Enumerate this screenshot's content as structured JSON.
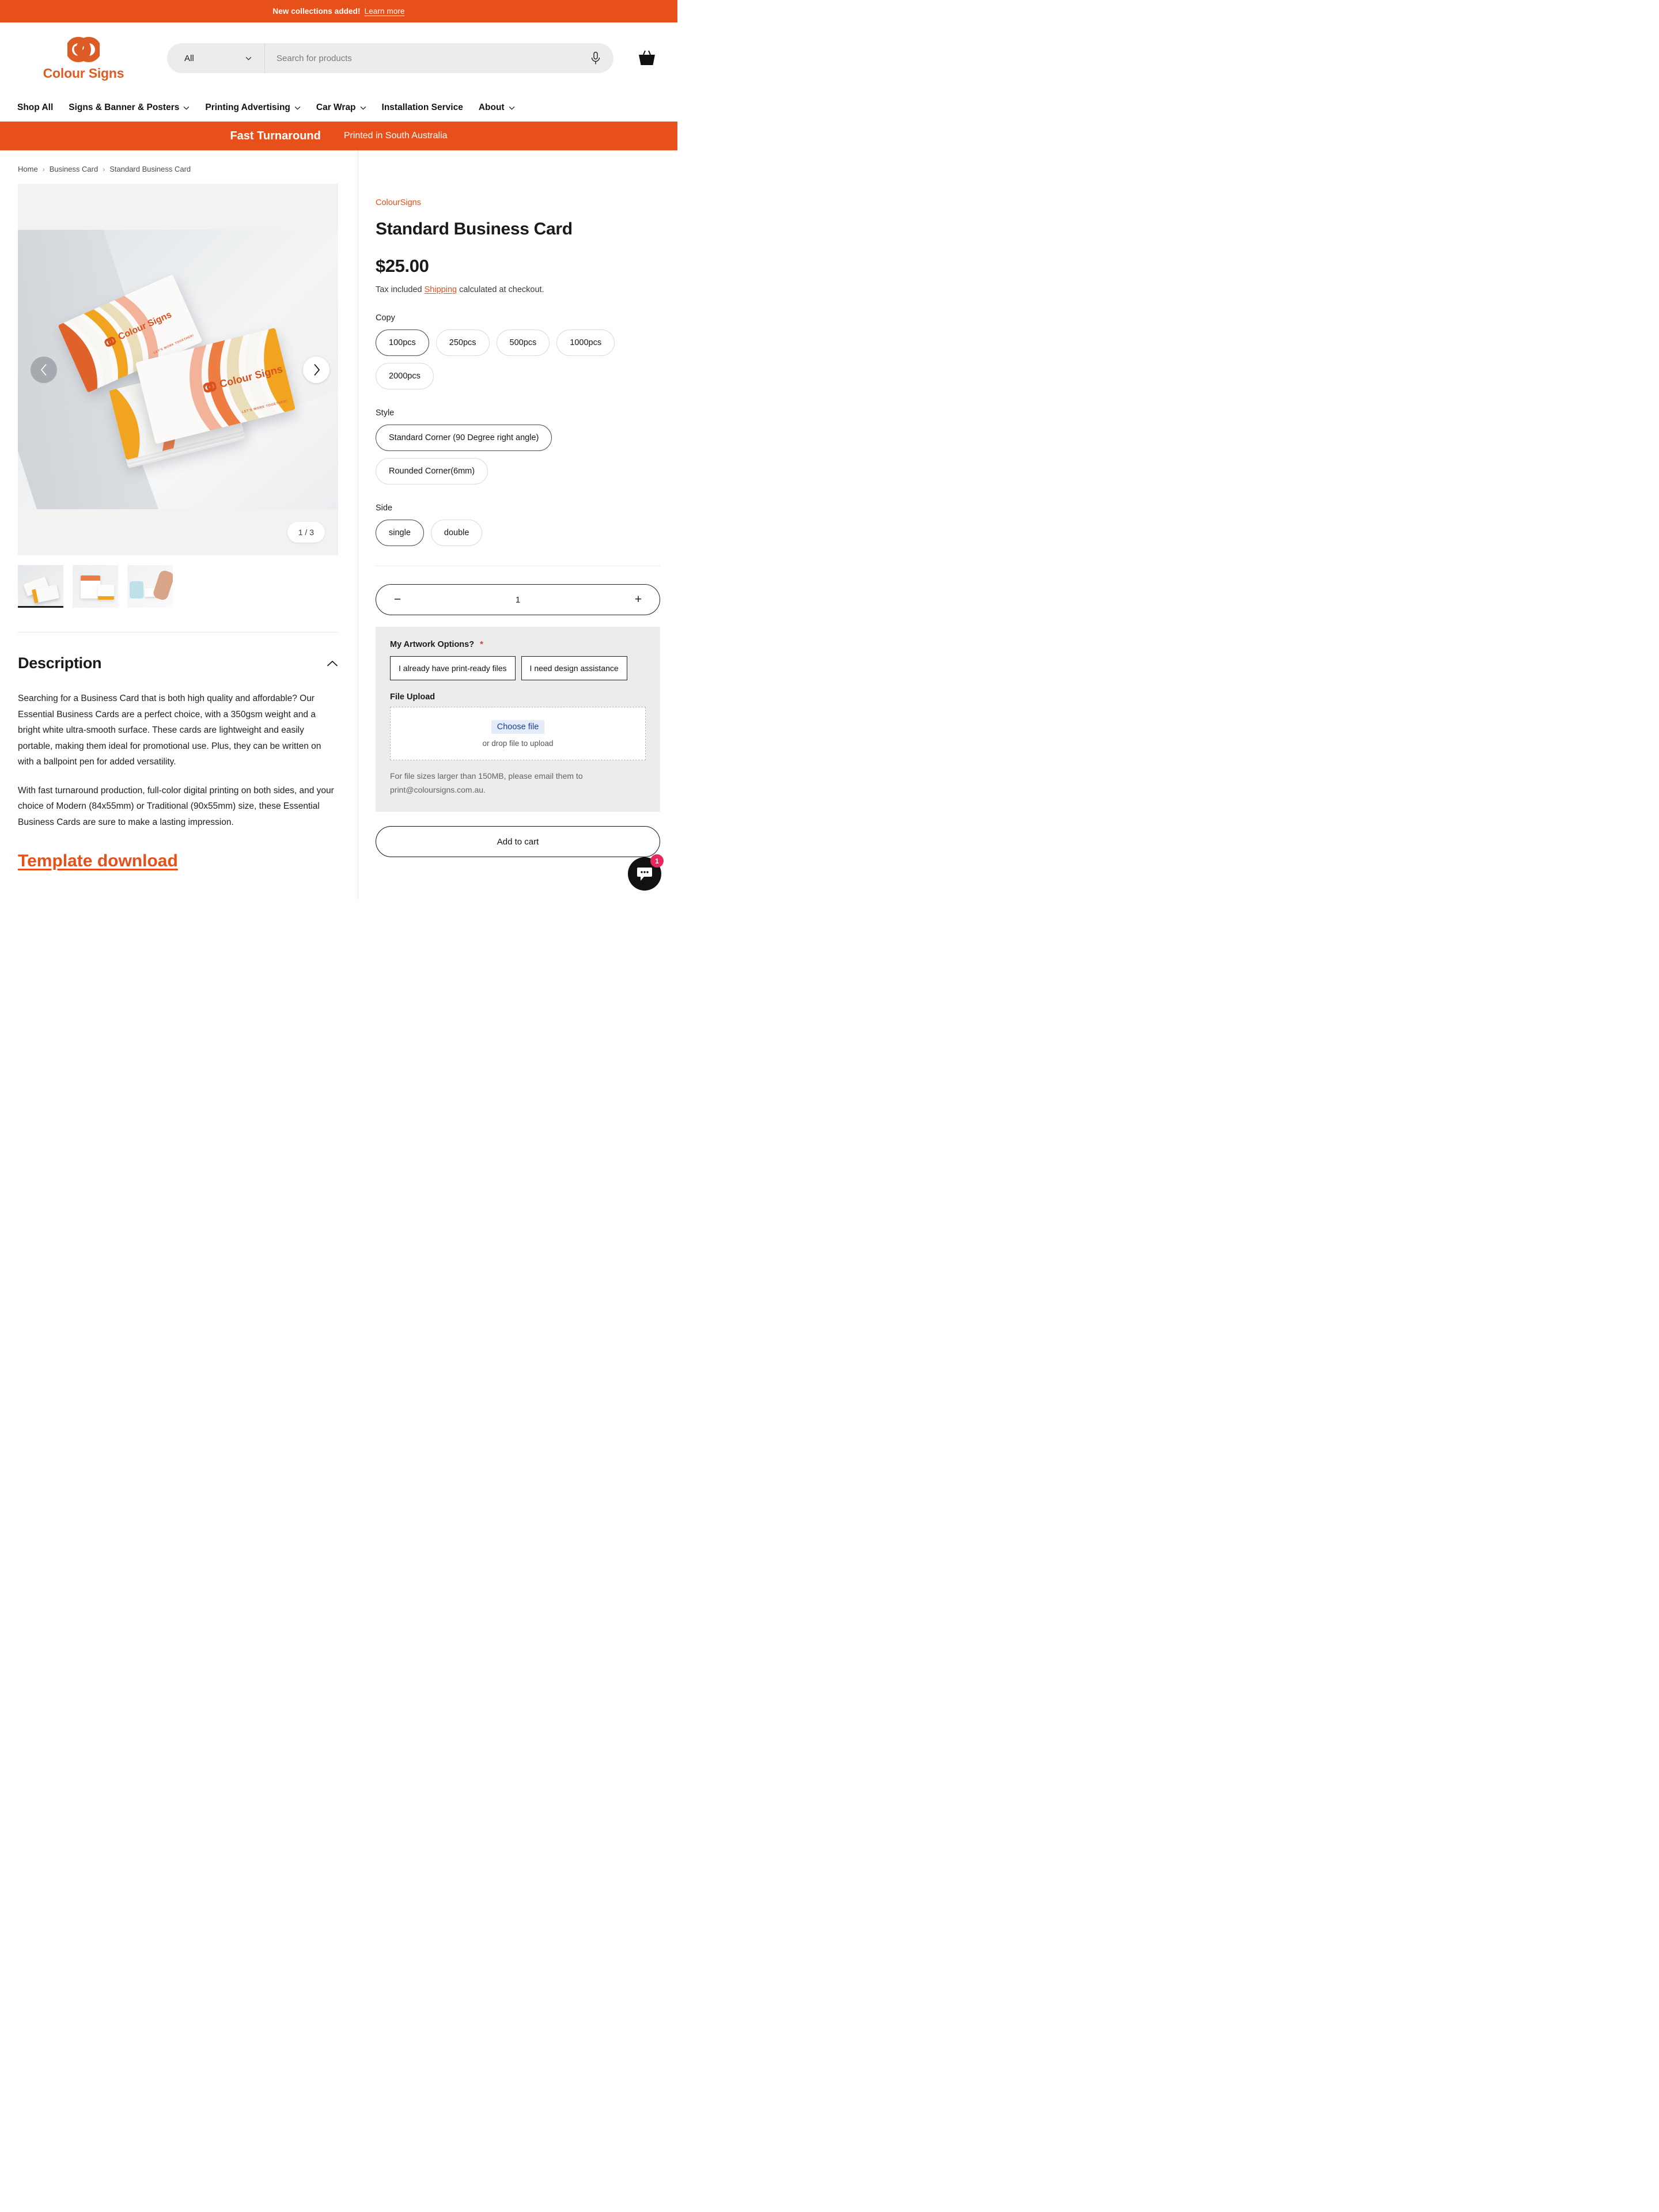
{
  "announcement": {
    "text": "New collections added!",
    "link_label": "Learn more"
  },
  "brand": {
    "name": "Colour Signs",
    "accent_color": "#e8501b",
    "logo_icon": "interlocking-rings-logo"
  },
  "search": {
    "category_value": "All",
    "placeholder": "Search for products",
    "value": "",
    "mic_icon": "microphone-icon",
    "dropdown_icon": "chevron-down-icon"
  },
  "cart": {
    "icon": "shopping-basket-icon"
  },
  "nav": {
    "items": [
      {
        "label": "Shop All",
        "has_dropdown": false
      },
      {
        "label": "Signs & Banner & Posters",
        "has_dropdown": true
      },
      {
        "label": "Printing Advertising",
        "has_dropdown": true
      },
      {
        "label": "Car Wrap",
        "has_dropdown": true
      },
      {
        "label": "Installation Service",
        "has_dropdown": false
      },
      {
        "label": "About",
        "has_dropdown": true
      }
    ]
  },
  "promo": {
    "primary": "Fast Turnaround",
    "secondary": "Printed in South Australia"
  },
  "breadcrumb": {
    "items": [
      "Home",
      "Business Card",
      "Standard Business Card"
    ],
    "separator": "›"
  },
  "gallery": {
    "counter": "1 / 3",
    "prev_icon": "chevron-left-icon",
    "next_icon": "chevron-right-icon",
    "card_brand": "Colour Signs",
    "card_tagline": "LET'S WORK TOGETHER!",
    "thumbnails": [
      {
        "name": "business-cards-stack",
        "active": true
      },
      {
        "name": "business-cards-flatlay",
        "active": false
      },
      {
        "name": "business-card-in-hand",
        "active": false
      }
    ]
  },
  "description": {
    "heading": "Description",
    "collapse_icon": "chevron-up-icon",
    "paragraphs": [
      "Searching for a Business Card that is both high quality and affordable? Our Essential Business Cards are a perfect choice, with a 350gsm weight and a bright white ultra-smooth surface. These cards are lightweight and easily portable, making them ideal for promotional use. Plus, they can be written on with a ballpoint pen for added versatility.",
      " With fast turnaround production, full-color digital printing on both sides, and your choice of Modern (84x55mm) or Traditional (90x55mm) size, these Essential Business Cards are sure to make a lasting impression."
    ],
    "template_link": "Template download"
  },
  "product": {
    "vendor": "ColourSigns",
    "title": "Standard Business Card",
    "price": "$25.00",
    "tax_prefix": "Tax included",
    "shipping_link": "Shipping",
    "tax_suffix": "calculated at checkout.",
    "options": [
      {
        "label": "Copy",
        "name": "copy",
        "values": [
          {
            "label": "100pcs",
            "selected": true
          },
          {
            "label": "250pcs",
            "selected": false
          },
          {
            "label": "500pcs",
            "selected": false
          },
          {
            "label": "1000pcs",
            "selected": false
          },
          {
            "label": "2000pcs",
            "selected": false
          }
        ]
      },
      {
        "label": "Style",
        "name": "style",
        "values": [
          {
            "label": "Standard Corner (90 Degree right angle)",
            "selected": true
          },
          {
            "label": "Rounded Corner(6mm)",
            "selected": false
          }
        ]
      },
      {
        "label": "Side",
        "name": "side",
        "values": [
          {
            "label": "single",
            "selected": true
          },
          {
            "label": "double",
            "selected": false
          }
        ]
      }
    ],
    "quantity": {
      "value": "1",
      "decrease_label": "−",
      "increase_label": "+"
    },
    "artwork": {
      "label": "My Artwork Options?",
      "required_mark": "*",
      "choices": [
        "I already have print-ready files",
        "I need design assistance"
      ],
      "upload_label": "File Upload",
      "choose_file_label": "Choose file",
      "drop_hint": "or drop file to upload",
      "note": "For file sizes larger than 150MB, please email them to print@coloursigns.com.au."
    },
    "add_to_cart": "Add to cart"
  },
  "chat": {
    "icon": "chat-bubble-icon",
    "badge": "1",
    "badge_color": "#e8285c"
  }
}
